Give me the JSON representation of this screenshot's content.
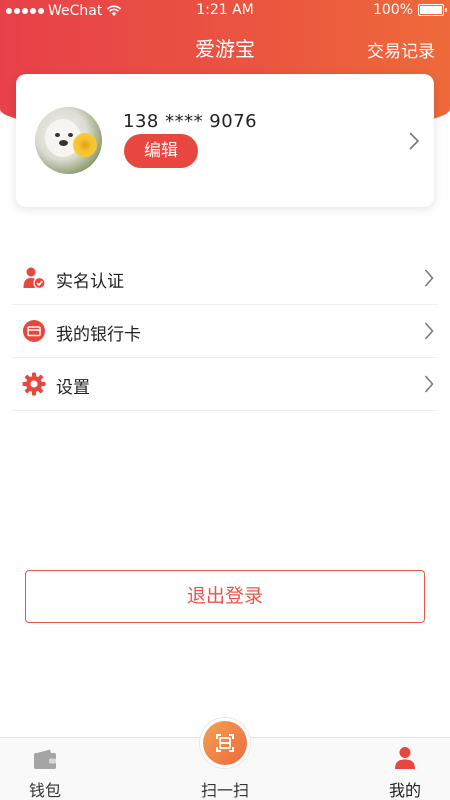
{
  "status_bar": {
    "carrier": "WeChat",
    "time": "1:21 AM",
    "battery": "100%"
  },
  "nav": {
    "title": "爱游宝",
    "right_action": "交易记录"
  },
  "profile": {
    "phone": "138 **** 9076",
    "edit_label": "编辑"
  },
  "menu": {
    "items": [
      {
        "label": "实名认证",
        "icon": "user-verify-icon"
      },
      {
        "label": "我的银行卡",
        "icon": "bank-card-icon"
      },
      {
        "label": "设置",
        "icon": "gear-icon"
      }
    ]
  },
  "logout_label": "退出登录",
  "tabbar": {
    "tabs": [
      {
        "label": "钱包",
        "icon": "wallet-icon",
        "active": false
      },
      {
        "label": "扫一扫",
        "icon": "scan-icon",
        "active": false
      },
      {
        "label": "我的",
        "icon": "user-icon",
        "active": true
      }
    ]
  },
  "colors": {
    "accent": "#e8473f",
    "header_gradient_start": "#e8414a",
    "header_gradient_end": "#ee6a3a",
    "inactive_tab": "#9a9a9a"
  }
}
